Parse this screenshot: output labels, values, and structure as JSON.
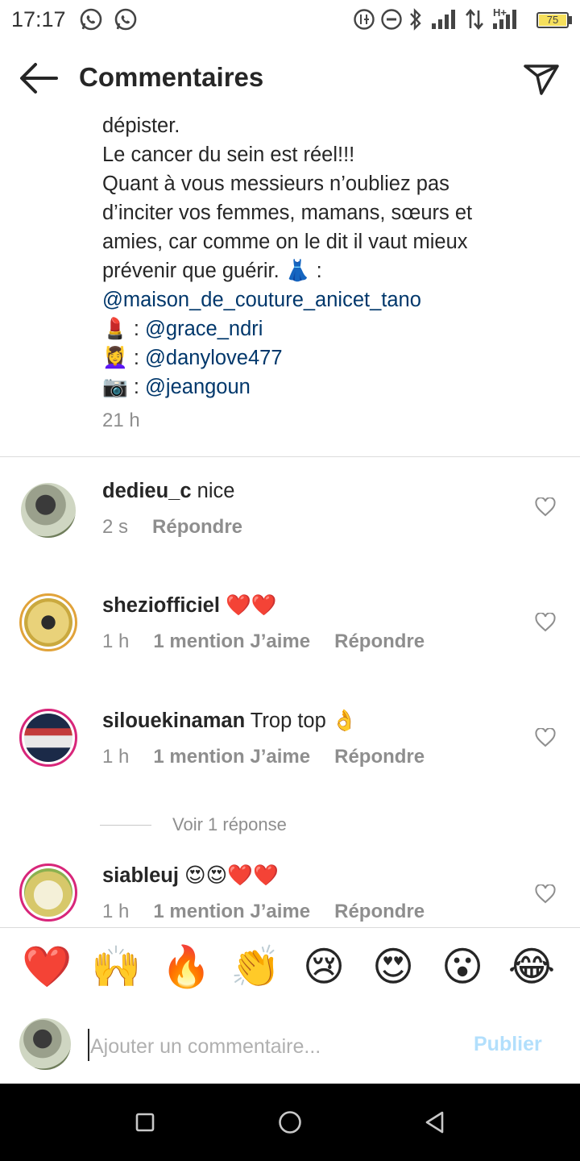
{
  "status_bar": {
    "time": "17:17",
    "left_icons": [
      "whatsapp-icon",
      "whatsapp-icon"
    ],
    "right_icons": [
      "data-saver-icon",
      "do-not-disturb-icon",
      "bluetooth-icon",
      "signal-icon",
      "data-arrows-icon",
      "signal-hplus-icon",
      "battery-icon"
    ],
    "network_label": "H+",
    "battery": "75"
  },
  "header": {
    "title": "Commentaires",
    "back_icon": "back-arrow-icon",
    "send_icon": "send-icon"
  },
  "caption": {
    "lines": [
      "dépister.",
      "Le cancer du sein est réel!!!",
      "Quant à vous messieurs n’oubliez pas",
      "d’inciter vos femmes, mamans, sœurs et",
      "amies, car comme on le dit il vaut mieux",
      "prévenir que guérir."
    ],
    "credits": [
      {
        "emoji": "👗",
        "separator": " :",
        "mention": "@maison_de_couture_anicet_tano"
      },
      {
        "emoji": "💄",
        "separator": " : ",
        "mention": "@grace_ndri"
      },
      {
        "emoji": "💆‍♀️",
        "separator": " : ",
        "mention": "@danylove477"
      },
      {
        "emoji": "📷",
        "separator": " : ",
        "mention": "@jeangoun"
      }
    ],
    "time": "21 h"
  },
  "comments": [
    {
      "username": "dedieu_c",
      "text": "nice",
      "time": "2 s",
      "likes": "",
      "reply": "Répondre"
    },
    {
      "username": "sheziofficiel",
      "text": "❤️❤️",
      "time": "1 h",
      "likes": "1 mention J’aime",
      "reply": "Répondre"
    },
    {
      "username": "silouekinaman",
      "text": "Trop top 👌",
      "time": "1 h",
      "likes": "1 mention J’aime",
      "reply": "Répondre"
    },
    {
      "username": "siableuj",
      "text": "😍😍❤️❤️",
      "time": "1 h",
      "likes": "1 mention J’aime",
      "reply": "Répondre"
    }
  ],
  "view_replies": "Voir 1 réponse",
  "quick_emojis": [
    "❤️",
    "🙌",
    "🔥",
    "👏",
    "😢",
    "😍",
    "😮",
    "😂"
  ],
  "compose": {
    "placeholder": "Ajouter un commentaire...",
    "publish": "Publier"
  },
  "nav_bar": [
    "recent-apps-icon",
    "home-icon",
    "back-icon"
  ],
  "colors": {
    "mention": "#00376b",
    "secondary_text": "#8e8e8e",
    "publish_disabled": "#b2dffc",
    "heart_red": "#ed4956"
  }
}
